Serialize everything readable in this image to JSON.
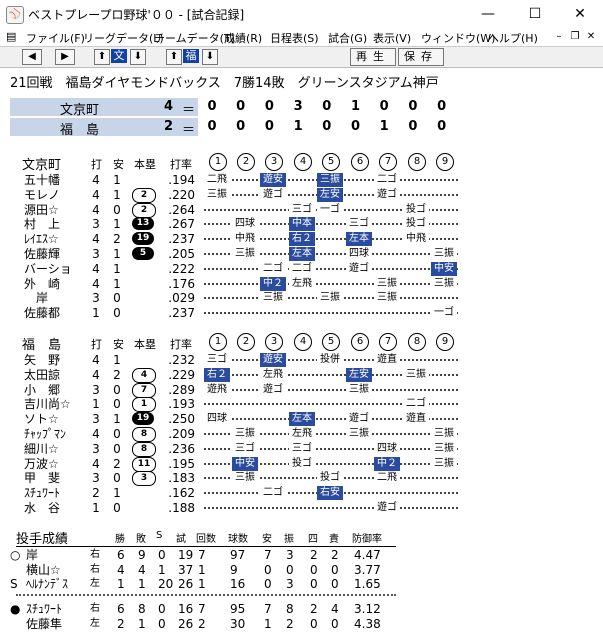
{
  "window": {
    "title": "ベストプレープロ野球'００ - [試合記録]",
    "icon": "baseball-app-icon",
    "minimize": "—",
    "maximize": "☐",
    "close": "✕"
  },
  "menu": [
    "ファイル(F)",
    "リーグデータ(L)",
    "チームデータ(T)",
    "成績(R)",
    "日程表(S)",
    "試合(G)",
    "表示(V)",
    "ウィンドウ(W)",
    "ヘルプ(H)"
  ],
  "toolbar": {
    "prev": "◀",
    "next": "▶",
    "up1": "⬆",
    "team1": "文",
    "down1": "⬇",
    "up2": "⬆",
    "team2": "福",
    "down2": "⬇",
    "play": "再生",
    "save": "保存"
  },
  "header": "21回戦　福島ダイヤモンドバックス　7勝14敗　グリーンスタジアム神戸",
  "scoreboard": [
    {
      "team": "文京町",
      "total": "4",
      "eq": "＝",
      "innings": [
        "0",
        "0",
        "0",
        "3",
        "0",
        "1",
        "0",
        "0",
        "0"
      ]
    },
    {
      "team": "福　島",
      "total": "2",
      "eq": "＝",
      "innings": [
        "0",
        "0",
        "0",
        "1",
        "0",
        "0",
        "1",
        "0",
        "0"
      ]
    }
  ],
  "batting_headers": {
    "ab": "打",
    "hit": "安",
    "hr": "本塁",
    "avg": "打率"
  },
  "inning_labels": [
    "1",
    "2",
    "3",
    "4",
    "5",
    "6",
    "7",
    "8",
    "9"
  ],
  "away": {
    "team": "文京町",
    "batters": [
      {
        "mark": "",
        "name": "五十幡",
        "ab": "4",
        "h": "1",
        "hr": "",
        "avg": ".194",
        "res": [
          [
            "二飛",
            0,
            0
          ],
          [
            "遊安",
            2,
            1
          ],
          [
            "三振",
            4,
            1
          ],
          [
            "二ゴ",
            6,
            0
          ]
        ]
      },
      {
        "mark": "",
        "name": "モレノ",
        "ab": "4",
        "h": "1",
        "hr": "2",
        "hrs": "w",
        "avg": ".220",
        "res": [
          [
            "三振",
            0,
            0
          ],
          [
            "遊ゴ",
            2,
            0
          ],
          [
            "左安",
            4,
            1
          ],
          [
            "遊ゴ",
            6,
            0
          ]
        ]
      },
      {
        "mark": "",
        "name": "源田☆",
        "ab": "4",
        "h": "0",
        "hr": "2",
        "hrs": "w",
        "avg": ".264",
        "res": [
          [
            "三ゴ",
            3,
            0
          ],
          [
            "一ゴ",
            4,
            0
          ],
          [
            "投ゴ",
            7,
            0
          ]
        ]
      },
      {
        "mark": "",
        "name": "村　上",
        "ab": "3",
        "h": "1",
        "hr": "13",
        "hrs": "b",
        "avg": ".267",
        "res": [
          [
            "四球",
            1,
            0
          ],
          [
            "中本",
            3,
            1
          ],
          [
            "三ゴ",
            5,
            0
          ],
          [
            "投ゴ",
            7,
            0
          ]
        ]
      },
      {
        "mark": "",
        "name": "ﾚｲｴｽ☆",
        "ab": "4",
        "h": "2",
        "hr": "19",
        "hrs": "b",
        "avg": ".237",
        "res": [
          [
            "中飛",
            1,
            0
          ],
          [
            "右２",
            3,
            1
          ],
          [
            "左本",
            5,
            1
          ],
          [
            "中飛",
            7,
            0
          ]
        ]
      },
      {
        "mark": "",
        "name": "佐藤輝",
        "ab": "3",
        "h": "1",
        "hr": "5",
        "hrs": "b",
        "avg": ".205",
        "res": [
          [
            "三振",
            1,
            0
          ],
          [
            "左本",
            3,
            1
          ],
          [
            "四球",
            5,
            0
          ],
          [
            "三振",
            8,
            0
          ]
        ]
      },
      {
        "mark": "",
        "name": "バーショ",
        "ab": "4",
        "h": "1",
        "hr": "",
        "avg": ".222",
        "res": [
          [
            "二ゴ",
            2,
            0
          ],
          [
            "二ゴ",
            3,
            0
          ],
          [
            "遊ゴ",
            5,
            0
          ],
          [
            "中安",
            8,
            1
          ]
        ]
      },
      {
        "mark": "",
        "name": "外　崎",
        "ab": "4",
        "h": "1",
        "hr": "",
        "avg": ".176",
        "res": [
          [
            "中２",
            2,
            1
          ],
          [
            "左飛",
            3,
            0
          ],
          [
            "三振",
            6,
            0
          ],
          [
            "三振",
            8,
            0
          ]
        ]
      },
      {
        "mark": "",
        "name": "　岸",
        "ab": "3",
        "h": "0",
        "hr": "",
        "avg": ".029",
        "res": [
          [
            "三振",
            2,
            0
          ],
          [
            "三振",
            4,
            0
          ],
          [
            "三振",
            6,
            0
          ]
        ]
      },
      {
        "mark": "",
        "name": "佐藤都",
        "ab": "1",
        "h": "0",
        "hr": "",
        "avg": ".237",
        "res": [
          [
            "一ゴ",
            8,
            0
          ]
        ]
      }
    ]
  },
  "home": {
    "team": "福　島",
    "batters": [
      {
        "mark": "",
        "name": "矢　野",
        "ab": "4",
        "h": "1",
        "hr": "",
        "avg": ".232",
        "res": [
          [
            "三ゴ",
            0,
            0
          ],
          [
            "遊安",
            2,
            1
          ],
          [
            "投併",
            4,
            0
          ],
          [
            "遊直",
            6,
            0
          ]
        ]
      },
      {
        "mark": "",
        "name": "太田諒",
        "ab": "4",
        "h": "2",
        "hr": "4",
        "hrs": "w",
        "avg": ".229",
        "res": [
          [
            "右２",
            0,
            1
          ],
          [
            "左飛",
            2,
            0
          ],
          [
            "左安",
            5,
            1
          ],
          [
            "三振",
            7,
            0
          ]
        ]
      },
      {
        "mark": "",
        "name": "小　郷",
        "ab": "3",
        "h": "0",
        "hr": "7",
        "hrs": "w",
        "avg": ".289",
        "res": [
          [
            "遊飛",
            0,
            0
          ],
          [
            "遊ゴ",
            2,
            0
          ],
          [
            "三振",
            5,
            0
          ]
        ]
      },
      {
        "mark": "",
        "name": "吉川尚☆",
        "ab": "1",
        "h": "0",
        "hr": "1",
        "hrs": "w",
        "avg": ".193",
        "res": [
          [
            "二ゴ",
            7,
            0
          ]
        ]
      },
      {
        "mark": "",
        "name": "ソト☆",
        "ab": "3",
        "h": "1",
        "hr": "19",
        "hrs": "b",
        "avg": ".250",
        "res": [
          [
            "四球",
            0,
            0
          ],
          [
            "左本",
            3,
            1
          ],
          [
            "遊ゴ",
            5,
            0
          ],
          [
            "遊直",
            7,
            0
          ]
        ]
      },
      {
        "mark": "",
        "name": "ﾁｬｯﾌﾟﾏﾝ",
        "ab": "4",
        "h": "0",
        "hr": "8",
        "hrs": "w",
        "avg": ".209",
        "res": [
          [
            "三振",
            1,
            0
          ],
          [
            "左飛",
            3,
            0
          ],
          [
            "三振",
            5,
            0
          ],
          [
            "三振",
            8,
            0
          ]
        ]
      },
      {
        "mark": "",
        "name": "細川☆",
        "ab": "3",
        "h": "0",
        "hr": "8",
        "hrs": "w",
        "avg": ".236",
        "res": [
          [
            "三ゴ",
            1,
            0
          ],
          [
            "三ゴ",
            3,
            0
          ],
          [
            "四球",
            6,
            0
          ],
          [
            "三振",
            8,
            0
          ]
        ]
      },
      {
        "mark": "",
        "name": "万波☆",
        "ab": "4",
        "h": "2",
        "hr": "11",
        "hrs": "w",
        "avg": ".195",
        "res": [
          [
            "中安",
            1,
            1
          ],
          [
            "投ゴ",
            3,
            0
          ],
          [
            "中２",
            6,
            1
          ],
          [
            "三振",
            8,
            0
          ]
        ]
      },
      {
        "mark": "",
        "name": "甲　斐",
        "ab": "3",
        "h": "0",
        "hr": "3",
        "hrs": "w",
        "avg": ".183",
        "res": [
          [
            "三振",
            1,
            0
          ],
          [
            "投ゴ",
            4,
            0
          ],
          [
            "二飛",
            6,
            0
          ]
        ]
      },
      {
        "mark": "",
        "name": "ｽﾁｭﾜｰﾄ",
        "ab": "2",
        "h": "1",
        "hr": "",
        "avg": ".162",
        "res": [
          [
            "二ゴ",
            2,
            0
          ],
          [
            "右安",
            4,
            1
          ]
        ]
      },
      {
        "mark": "",
        "name": "水　谷",
        "ab": "1",
        "h": "0",
        "hr": "",
        "avg": ".188",
        "res": [
          [
            "遊ゴ",
            6,
            0
          ]
        ]
      }
    ]
  },
  "pitching": {
    "title": "投手成績",
    "headers": [
      "勝",
      "敗",
      "S",
      "試",
      "回数",
      "球数",
      "安",
      "振",
      "四",
      "責",
      "防御率"
    ],
    "away": [
      {
        "mark": "○",
        "name": "岸",
        "hand": "右",
        "w": "6",
        "l": "9",
        "s": "0",
        "g": "19",
        "ip": "7",
        "np": "97",
        "h": "7",
        "so": "3",
        "bb": "2",
        "er": "2",
        "era": "4.47"
      },
      {
        "mark": "",
        "name": "横山☆",
        "hand": "右",
        "w": "4",
        "l": "4",
        "s": "1",
        "g": "37",
        "ip": "1",
        "np": "9",
        "h": "0",
        "so": "0",
        "bb": "0",
        "er": "0",
        "era": "3.77"
      },
      {
        "mark": "S",
        "name": "ﾍﾙﾅﾝﾃﾞｽ",
        "hand": "左",
        "w": "1",
        "l": "1",
        "s": "20",
        "g": "26",
        "ip": "1",
        "np": "16",
        "h": "0",
        "so": "3",
        "bb": "0",
        "er": "0",
        "era": "1.65"
      }
    ],
    "home": [
      {
        "mark": "●",
        "name": "ｽﾁｭﾜｰﾄ",
        "hand": "右",
        "w": "6",
        "l": "8",
        "s": "0",
        "g": "16",
        "ip": "7",
        "np": "95",
        "h": "7",
        "so": "8",
        "bb": "2",
        "er": "4",
        "era": "3.12"
      },
      {
        "mark": "",
        "name": "佐藤隼",
        "hand": "左",
        "w": "2",
        "l": "1",
        "s": "0",
        "g": "26",
        "ip": "2",
        "np": "30",
        "h": "1",
        "so": "2",
        "bb": "0",
        "er": "0",
        "era": "4.38"
      }
    ]
  }
}
